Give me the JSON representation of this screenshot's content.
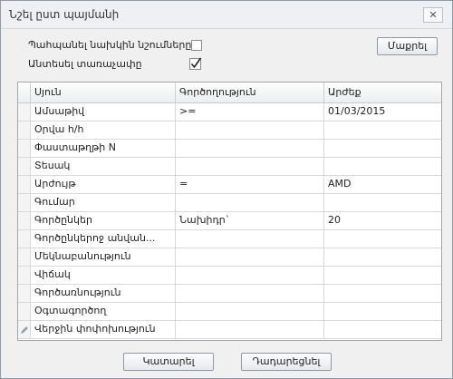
{
  "dialog": {
    "title": "Նշել ըստ պայմանի",
    "close_glyph": "✕"
  },
  "options": {
    "keep_previous_label": "Պահպանել նախկին նշումները",
    "keep_previous_checked": false,
    "sort_label": "Անտեսել տառաչափը",
    "sort_checked": true
  },
  "buttons": {
    "clear": "Մաքրել",
    "execute": "Կատարել",
    "cancel": "Դադարեցնել"
  },
  "grid": {
    "columns": [
      "Սյուն",
      "Գործողություն",
      "Արժեք"
    ],
    "rows": [
      {
        "column": "Ամսաթիվ",
        "operation": ">=",
        "value": "01/03/2015"
      },
      {
        "column": "Օրվա հ/հ",
        "operation": "",
        "value": ""
      },
      {
        "column": "Փաստաթղթի N",
        "operation": "",
        "value": ""
      },
      {
        "column": "Տեսակ",
        "operation": "",
        "value": ""
      },
      {
        "column": "Արժույթ",
        "operation": "=",
        "value": "AMD"
      },
      {
        "column": "Գումար",
        "operation": "",
        "value": ""
      },
      {
        "column": "Գործընկեր",
        "operation": "Նախիդր`",
        "value": "20"
      },
      {
        "column": "Գործընկերոջ անվան...",
        "operation": "",
        "value": ""
      },
      {
        "column": "Մեկնաբանություն",
        "operation": "",
        "value": ""
      },
      {
        "column": "Վիճակ",
        "operation": "",
        "value": ""
      },
      {
        "column": "Գործառնություն",
        "operation": "",
        "value": ""
      },
      {
        "column": "Օգտագործող",
        "operation": "",
        "value": ""
      },
      {
        "column": "Վերջին փոփոխություն",
        "operation": "",
        "value": ""
      }
    ]
  }
}
